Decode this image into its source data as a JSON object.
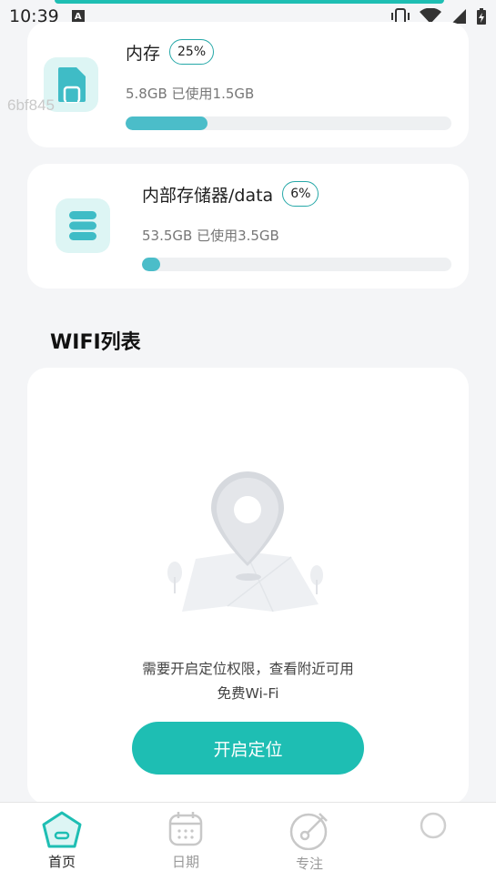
{
  "status_bar": {
    "time": "10:39",
    "notification_glyph": "A"
  },
  "watermark": "6bf845",
  "storage": [
    {
      "title": "内存",
      "percent_label": "25%",
      "detail": "5.8GB 已使用1.5GB",
      "used_fraction": 0.25,
      "icon": "sim-card-icon"
    },
    {
      "title": "内部存储器/data",
      "percent_label": "6%",
      "detail": "53.5GB 已使用3.5GB",
      "used_fraction": 0.06,
      "icon": "database-icon"
    }
  ],
  "wifi": {
    "section_title": "WIFI列表",
    "permission_text_line1": "需要开启定位权限，查看附近可用",
    "permission_text_line2": "免费Wi-Fi",
    "button_label": "开启定位"
  },
  "nav": [
    {
      "label": "首页",
      "icon": "home-icon",
      "active": true
    },
    {
      "label": "日期",
      "icon": "calendar-icon",
      "active": false
    },
    {
      "label": "专注",
      "icon": "focus-icon",
      "active": false
    },
    {
      "label": "",
      "icon": "loading-icon",
      "active": false
    }
  ],
  "colors": {
    "accent": "#1ebeb3",
    "bar": "#4bbdc9",
    "icon_bg": "#ddf5f4",
    "background": "#f4f5f7"
  }
}
